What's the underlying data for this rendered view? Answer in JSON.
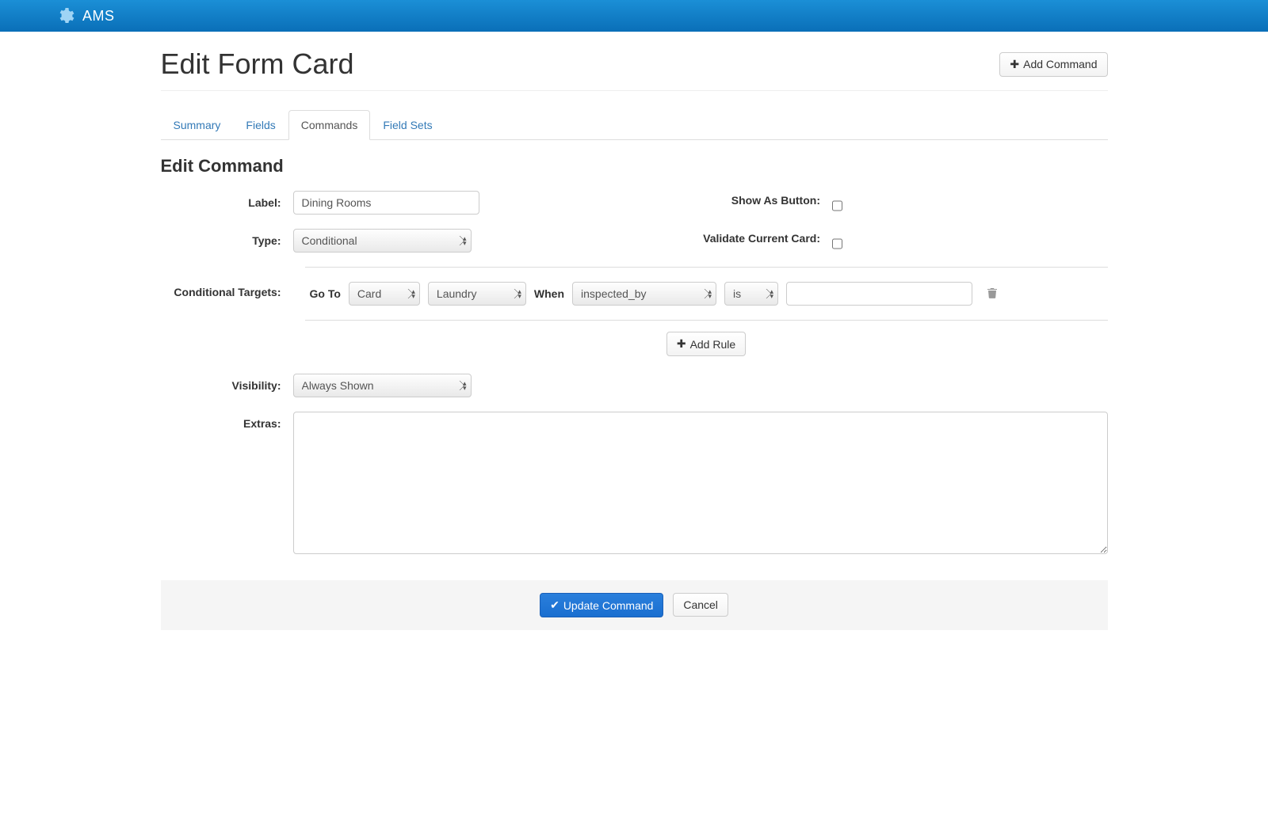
{
  "brand": "AMS",
  "page_title": "Edit Form Card",
  "add_command_label": "Add Command",
  "tabs": {
    "summary": "Summary",
    "fields": "Fields",
    "commands": "Commands",
    "field_sets": "Field Sets"
  },
  "section_title": "Edit Command",
  "labels": {
    "label": "Label:",
    "type": "Type:",
    "show_as_button": "Show As Button:",
    "validate_current_card": "Validate Current Card:",
    "conditional_targets": "Conditional Targets:",
    "visibility": "Visibility:",
    "extras": "Extras:"
  },
  "values": {
    "label": "Dining Rooms",
    "type": "Conditional",
    "show_as_button": false,
    "validate_current_card": false,
    "visibility": "Always Shown",
    "extras": ""
  },
  "rule": {
    "go_to_label": "Go To",
    "target_type": "Card",
    "target_value": "Laundry",
    "when_label": "When",
    "field": "inspected_by",
    "operator": "is",
    "compare_value": ""
  },
  "add_rule_label": "Add Rule",
  "actions": {
    "update": "Update Command",
    "cancel": "Cancel"
  }
}
